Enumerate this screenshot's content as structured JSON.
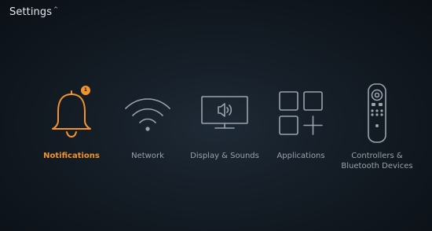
{
  "header": {
    "title": "Settings"
  },
  "menu": {
    "items": [
      {
        "label": "Notifications",
        "icon": "bell-icon",
        "badge": "1",
        "active": true
      },
      {
        "label": "Network",
        "icon": "wifi-icon",
        "active": false
      },
      {
        "label": "Display & Sounds",
        "icon": "tv-speaker-icon",
        "active": false
      },
      {
        "label": "Applications",
        "icon": "apps-grid-icon",
        "active": false
      },
      {
        "label": "Controllers &\nBluetooth Devices",
        "icon": "remote-control-icon",
        "active": false
      }
    ]
  },
  "colors": {
    "accent": "#f0942e",
    "inactive_icon": "#9aa3ab",
    "background": "#141c25"
  }
}
